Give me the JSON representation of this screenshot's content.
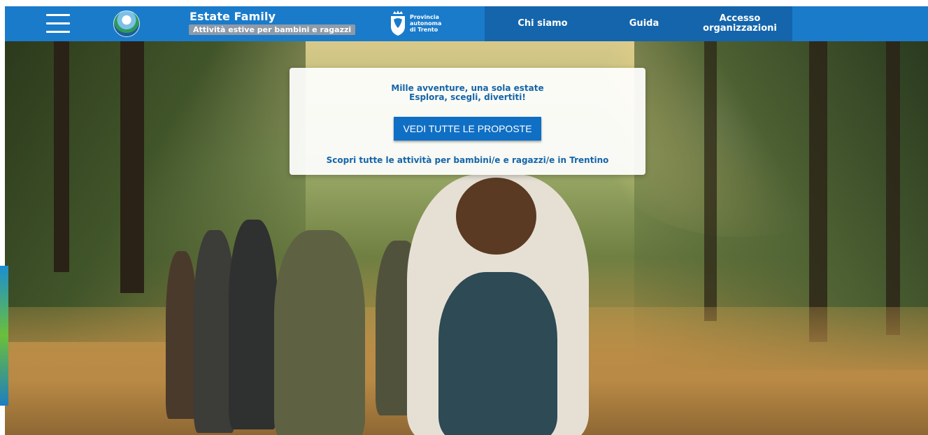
{
  "header": {
    "brand_title": "Estate Family",
    "brand_subtitle": "Attività estive per bambini e ragazzi",
    "pat_logo_lines": [
      "Provincia",
      "autonoma",
      "di Trento"
    ],
    "nav": [
      {
        "label": "Chi siamo"
      },
      {
        "label": "Guida"
      },
      {
        "label_line1": "Accesso",
        "label_line2": "organizzazioni"
      }
    ]
  },
  "hero": {
    "tagline_line1": "Mille avventure, una sola estate",
    "tagline_line2": "Esplora, scegli, divertiti!",
    "cta_label": "VEDI TUTTE LE PROPOSTE",
    "discover_text": "Scopri tutte le attività per bambini/e e ragazzi/e in Trentino"
  },
  "colors": {
    "header_bg": "#1a7bcb",
    "nav_block_bg": "#1465ab",
    "accent_text": "#1565a8",
    "cta_bg": "#0f6fc4"
  },
  "icons": {
    "menu": "hamburger-menu-icon",
    "logo": "estate-family-logo",
    "crest": "provincia-trento-crest"
  }
}
